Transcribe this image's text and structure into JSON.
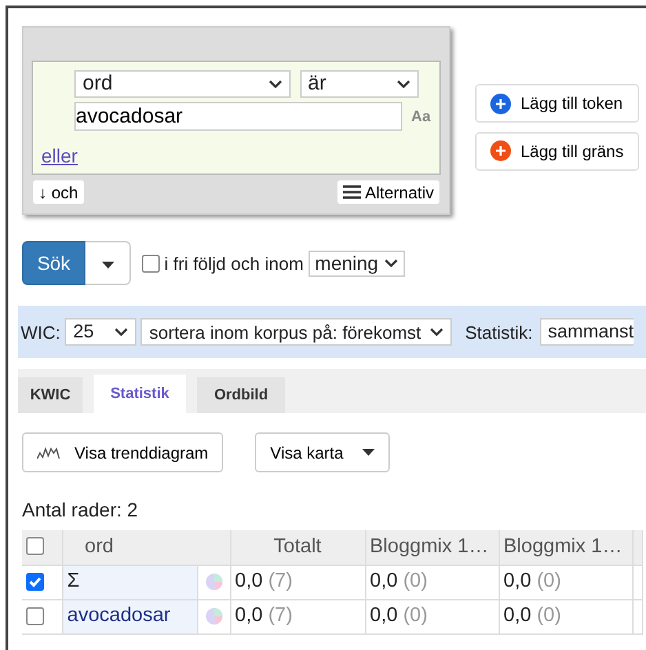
{
  "query": {
    "token": {
      "attribute": "ord",
      "operator": "är",
      "value": "avocadosar",
      "case_toggle": "Aa",
      "or_link": "eller"
    },
    "and_button": "↓ och",
    "options_button": "Alternativ"
  },
  "side_buttons": [
    {
      "label": "Lägg till token",
      "color": "#1b66e0"
    },
    {
      "label": "Lägg till gräns",
      "color": "#f04e14"
    }
  ],
  "search": {
    "button": "Sök",
    "in_order": {
      "label": "i fri följd och inom",
      "checked": false
    },
    "scope": "mening"
  },
  "settings_bar": {
    "kwic_label": "WIC:",
    "kwic_count": "25",
    "sort": "sortera inom korpus på: förekomst",
    "stats_label": "Statistik:",
    "stats_value": "sammanst"
  },
  "tabs": [
    {
      "label": "KWIC",
      "selected": false
    },
    {
      "label": "Statistik",
      "selected": true
    },
    {
      "label": "Ordbild",
      "selected": false
    }
  ],
  "actions": {
    "trend_button": "Visa trenddiagram",
    "map_button": "Visa karta"
  },
  "row_count": "Antal rader: 2",
  "table": {
    "columns": [
      "ord",
      "Totalt",
      "Bloggmix 1…",
      "Bloggmix 1…"
    ],
    "all_checked": false,
    "rows": [
      {
        "checked": true,
        "kind": "sum",
        "cells": [
          {
            "kind": "word",
            "text": "Σ"
          },
          {
            "value": "0,0",
            "count": "(7)"
          },
          {
            "value": "0,0",
            "count": "(0)"
          },
          {
            "value": "0,0",
            "count": "(0)"
          }
        ]
      },
      {
        "checked": false,
        "kind": "word",
        "cells": [
          {
            "kind": "word",
            "text": "avocadosar"
          },
          {
            "value": "0,0",
            "count": "(7)"
          },
          {
            "value": "0,0",
            "count": "(0)"
          },
          {
            "value": "0,0",
            "count": "(0)"
          }
        ]
      }
    ]
  }
}
